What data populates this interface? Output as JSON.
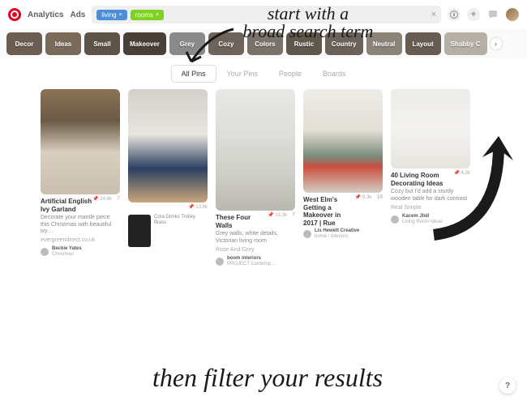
{
  "annotations": {
    "top": "start with a\nbroad search term",
    "bottom": "then filter your results"
  },
  "nav": {
    "analytics": "Analytics",
    "ads": "Ads"
  },
  "search": {
    "tags": [
      {
        "label": "living",
        "color": "#4a90d9"
      },
      {
        "label": "rooms",
        "color": "#7ed321"
      }
    ],
    "clear": "×"
  },
  "plus": "+",
  "filters": [
    {
      "label": "Decor",
      "bg": "#6b5d52"
    },
    {
      "label": "Ideas",
      "bg": "#7a6a5a"
    },
    {
      "label": "Small",
      "bg": "#5c5248"
    },
    {
      "label": "Makeover",
      "bg": "#4a3f36"
    },
    {
      "label": "Grey",
      "bg": "#8a8a8a"
    },
    {
      "label": "Cozy",
      "bg": "#6e635a"
    },
    {
      "label": "Colors",
      "bg": "#7a7268"
    },
    {
      "label": "Rustic",
      "bg": "#5f564c"
    },
    {
      "label": "Country",
      "bg": "#6b6158"
    },
    {
      "label": "Neutral",
      "bg": "#8b8378"
    },
    {
      "label": "Layout",
      "bg": "#665c52"
    },
    {
      "label": "Shabby C",
      "bg": "#b5afa6"
    }
  ],
  "tabs": {
    "all": "All Pins",
    "your": "Your Pins",
    "people": "People",
    "boards": "Boards"
  },
  "pins": [
    {
      "title": "Artificial English Ivy Garland",
      "desc": "Decorate your mantle piece this Christmas with beautiful ivy…",
      "source": "evergreendirect.co.uk",
      "saves": "24.6k",
      "comments": "7",
      "author": {
        "name": "Beckie Yates",
        "board": "Christmas"
      },
      "thumb": {
        "h": 130,
        "bg": "linear-gradient(180deg,#8b7355 0%,#6b5a45 30%,#d9cfc0 60%,#c9beb0 100%)"
      }
    },
    {
      "title": "",
      "desc": "",
      "source": "",
      "saves": "13.6k",
      "comments": "",
      "author": null,
      "thumb": {
        "h": 140,
        "bg": "linear-gradient(180deg,#d4d0cc 0%,#e8e4de 40%,#2a3f5f 70%,#c9a87c 100%)"
      },
      "product": {
        "name": "Cora Drinks Trolley",
        "brand": "Brass"
      }
    },
    {
      "title": "These Four Walls",
      "desc": "Grey walls, white details, Victorian living room",
      "source": "Rose And Grey",
      "saves": "13.3k",
      "comments": "7",
      "author": {
        "name": "boom interiors",
        "board": "PROJECT Contemp…"
      },
      "thumb": {
        "h": 150,
        "bg": "linear-gradient(180deg,#e8e8e6 0%,#dcdcd8 40%,#cfcfc8 70%,#b8b8b0 100%)"
      }
    },
    {
      "title": "West Elm's Getting a Makeover in 2017 | Rue",
      "desc": "",
      "source": "",
      "saves": "9.3k",
      "comments": "18",
      "author": {
        "name": "Lis Hewett Creative",
        "board": "home / interiors"
      },
      "thumb": {
        "h": 128,
        "bg": "linear-gradient(180deg,#efede8 0%,#e2ded5 40%,#7a8a7a 65%,#c94f3f 75%,#d4cfc5 100%)"
      }
    },
    {
      "title": "40 Living Room Decorating Ideas",
      "desc": "Cozy but I'd add a sturdy wooden table for dark contrast",
      "source": "Real Simple",
      "saves": "4.2k",
      "comments": "",
      "author": {
        "name": "Kacem Jlidi",
        "board": "Living Room Ideas"
      },
      "thumb": {
        "h": 98,
        "bg": "linear-gradient(180deg,#ecebe7 0%,#f4f3ef 50%,#e6e4de 100%)"
      }
    }
  ],
  "help": "?"
}
